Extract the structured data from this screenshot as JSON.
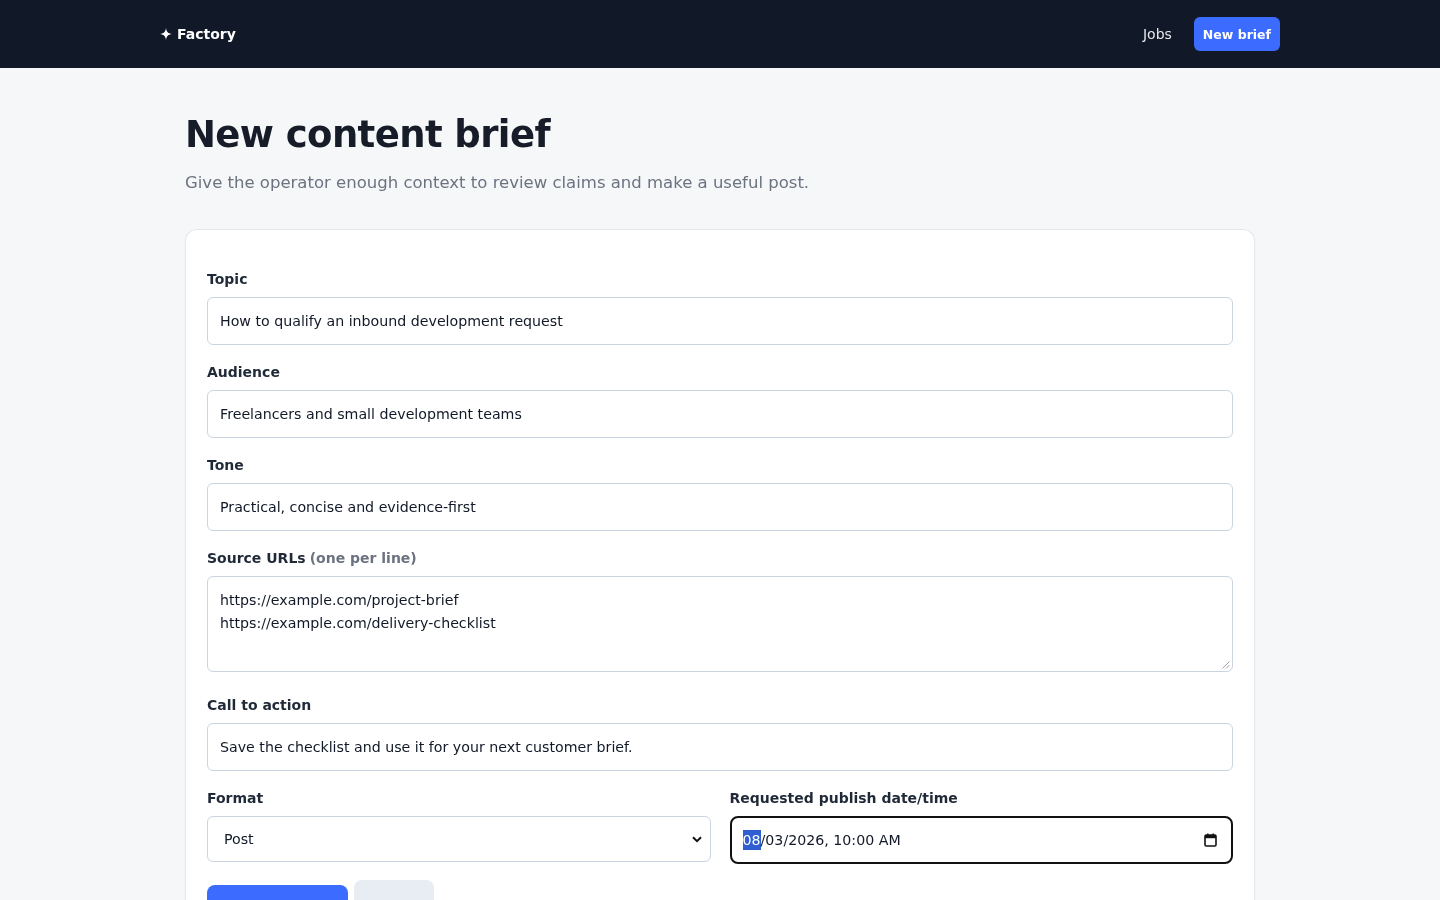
{
  "nav": {
    "brand": "Factory",
    "links": [
      {
        "label": "Jobs"
      }
    ],
    "button": "New brief"
  },
  "page": {
    "title": "New content brief",
    "subtitle": "Give the operator enough context to review claims and make a useful post."
  },
  "form": {
    "fields": [
      {
        "kind": "text",
        "label": "Topic",
        "value": "How to qualify an inbound development request"
      },
      {
        "kind": "text",
        "label": "Audience",
        "value": "Freelancers and small development teams"
      },
      {
        "kind": "text",
        "label": "Tone",
        "value": "Practical, concise and evidence-first"
      },
      {
        "kind": "textarea",
        "label": "Source URLs",
        "hint": "(one per line)",
        "lines": [
          "https://example.com/project-brief",
          "https://example.com/delivery-checklist"
        ]
      },
      {
        "kind": "text",
        "label": "Call to action",
        "value": "Save the checklist and use it for your next customer brief."
      }
    ],
    "row": [
      {
        "kind": "select",
        "label": "Format",
        "value": "Post"
      },
      {
        "kind": "datetime",
        "label": "Requested publish date/time",
        "focused": true,
        "segments": [
          {
            "text": "08",
            "selected": true
          },
          {
            "text": "/03/2026, 10:00 AM",
            "selected": false
          }
        ]
      }
    ],
    "actions": [
      {
        "kind": "primary"
      },
      {
        "kind": "secondary"
      }
    ]
  }
}
